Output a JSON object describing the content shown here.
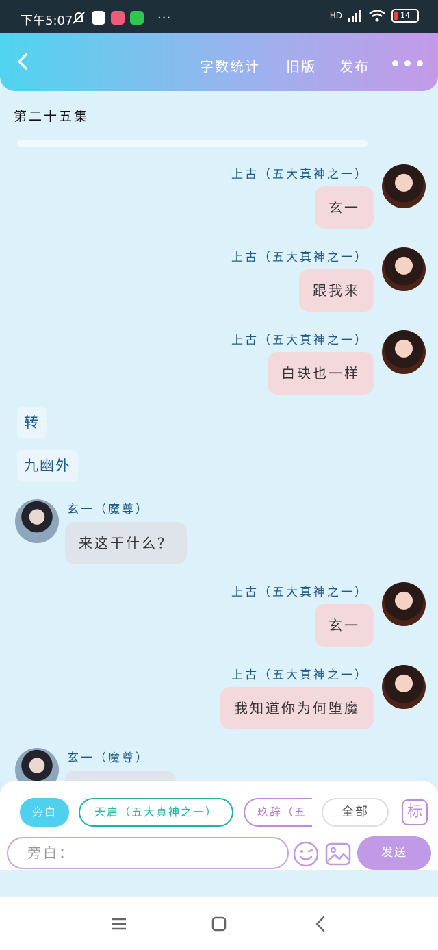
{
  "status_bar": {
    "time": "下午5:07",
    "battery": "14",
    "network": "HD",
    "more": "···"
  },
  "header": {
    "links": [
      "字数统计",
      "旧版",
      "发布"
    ]
  },
  "episode_title": "第二十五集",
  "messages": [
    {
      "side": "right",
      "speaker": "上古（五大真神之一）",
      "text": "玄一"
    },
    {
      "side": "right",
      "speaker": "上古（五大真神之一）",
      "text": "跟我来"
    },
    {
      "side": "right",
      "speaker": "上古（五大真神之一）",
      "text": "白玦也一样"
    },
    {
      "type": "scene",
      "text": "转"
    },
    {
      "type": "scene",
      "text": "九幽外"
    },
    {
      "side": "left",
      "speaker": "玄一（魔尊）",
      "text": "来这干什么？"
    },
    {
      "side": "right",
      "speaker": "上古（五大真神之一）",
      "text": "玄一"
    },
    {
      "side": "right",
      "speaker": "上古（五大真神之一）",
      "text": "我知道你为何堕魔"
    },
    {
      "side": "left",
      "speaker": "玄一（魔尊）",
      "text": ""
    }
  ],
  "role_chips": {
    "narrator": "旁白",
    "tian_qi": "天启（五大真神之一）",
    "jiu_ci": "玖辞（五",
    "all": "全部",
    "mark": "标"
  },
  "composer": {
    "input_value": "旁白：",
    "send_label": "发送"
  },
  "colors": {
    "accent_cyan": "#4fd0ef",
    "accent_purple": "#c09ae6",
    "bubble_right": "#f3d9dc",
    "bubble_left": "#dfe4ea",
    "name_color": "#1c5a8a"
  }
}
